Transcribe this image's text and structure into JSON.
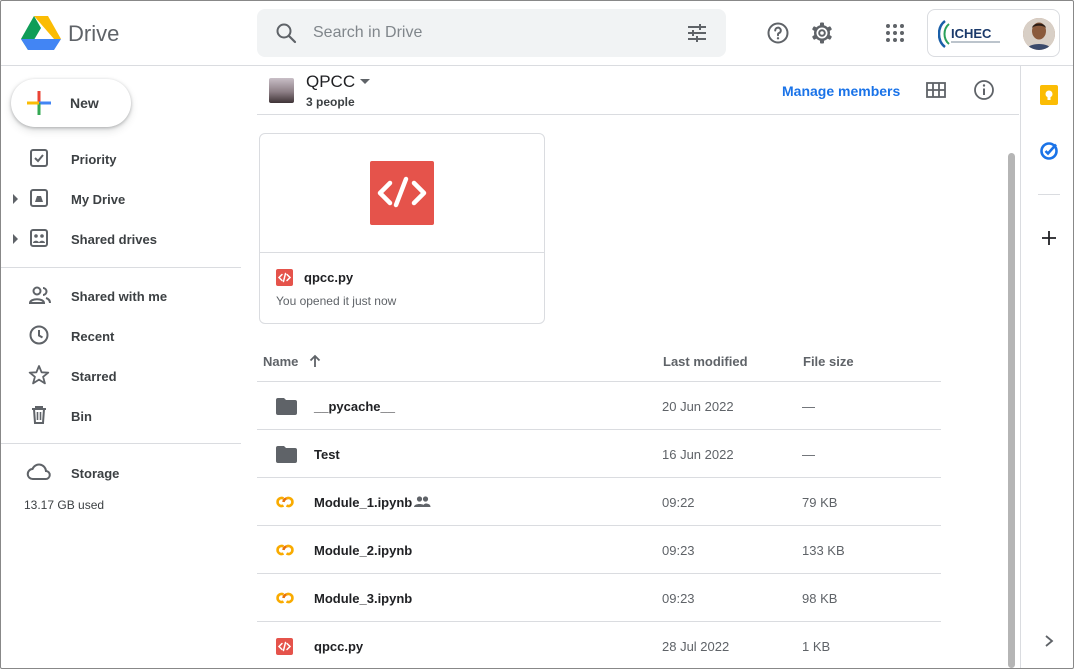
{
  "header": {
    "brand": "Drive",
    "search_placeholder": "Search in Drive",
    "account_logo_text": "ICHEC"
  },
  "sidebar": {
    "new_label": "New",
    "items": [
      {
        "label": "Priority",
        "icon": "priority-icon"
      },
      {
        "label": "My Drive",
        "icon": "my-drive-icon"
      },
      {
        "label": "Shared drives",
        "icon": "shared-drives-icon"
      },
      {
        "label": "Shared with me",
        "icon": "shared-with-me-icon"
      },
      {
        "label": "Recent",
        "icon": "clock-icon"
      },
      {
        "label": "Starred",
        "icon": "star-icon"
      },
      {
        "label": "Bin",
        "icon": "bin-icon"
      },
      {
        "label": "Storage",
        "icon": "cloud-icon"
      }
    ],
    "storage_used": "13.17 GB used"
  },
  "drive": {
    "name": "QPCC",
    "people": "3 people",
    "manage_label": "Manage members"
  },
  "suggested": {
    "name": "qpcc.py",
    "subtitle": "You opened it just now"
  },
  "table": {
    "columns": [
      "Name",
      "Last modified",
      "File size"
    ],
    "rows": [
      {
        "name": "__pycache__",
        "modified": "20 Jun 2022",
        "size": "—",
        "type": "folder"
      },
      {
        "name": "Test",
        "modified": "16 Jun 2022",
        "size": "—",
        "type": "folder"
      },
      {
        "name": "Module_1.ipynb",
        "modified": "09:22",
        "size": "79 KB",
        "type": "colab",
        "shared": true
      },
      {
        "name": "Module_2.ipynb",
        "modified": "09:23",
        "size": "133 KB",
        "type": "colab"
      },
      {
        "name": "Module_3.ipynb",
        "modified": "09:23",
        "size": "98 KB",
        "type": "colab"
      },
      {
        "name": "qpcc.py",
        "modified": "28 Jul 2022",
        "size": "1 KB",
        "type": "code"
      }
    ]
  },
  "colors": {
    "accent": "#1a73e8",
    "code_red": "#e5534b",
    "colab_yellow": "#f9ab00",
    "folder_grey": "#5f6368"
  }
}
